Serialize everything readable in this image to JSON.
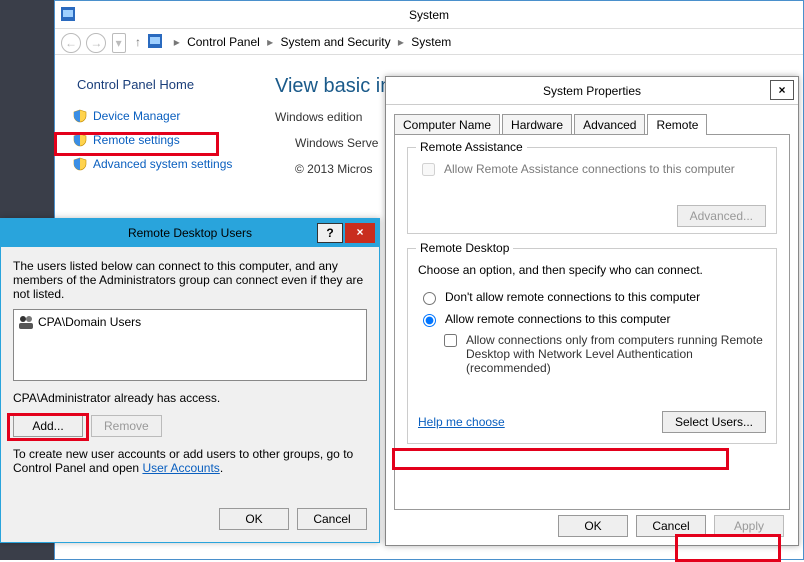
{
  "system_window": {
    "title": "System",
    "breadcrumb": {
      "seg1": "Control Panel",
      "seg2": "System and Security",
      "seg3": "System",
      "arrow": "▸"
    },
    "left": {
      "home": "Control Panel Home",
      "links": {
        "device_mgr": "Device Manager",
        "remote": "Remote settings",
        "advsys": "Advanced system settings"
      }
    },
    "right": {
      "heading": "View basic info",
      "edition_lbl": "Windows edition",
      "edition_val": "Windows Serve",
      "copyright": "© 2013 Micros"
    }
  },
  "props": {
    "title": "System Properties",
    "close": "×",
    "tabs": {
      "cn": "Computer Name",
      "hw": "Hardware",
      "adv": "Advanced",
      "rem": "Remote"
    },
    "ra": {
      "legend": "Remote Assistance",
      "allow": "Allow Remote Assistance connections to this computer",
      "advanced_btn": "Advanced..."
    },
    "rd": {
      "legend": "Remote Desktop",
      "choose": "Choose an option, and then specify who can connect.",
      "opt_deny": "Don't allow remote connections to this computer",
      "opt_allow": "Allow remote connections to this computer",
      "nla": "Allow connections only from computers running Remote Desktop with Network Level Authentication (recommended)",
      "help": "Help me choose",
      "select_users": "Select Users..."
    },
    "btns": {
      "ok": "OK",
      "cancel": "Cancel",
      "apply": "Apply"
    }
  },
  "rdu": {
    "title": "Remote Desktop Users",
    "help": "?",
    "close": "×",
    "desc": "The users listed below can connect to this computer, and any members of the Administrators group can connect even if they are not listed.",
    "list": {
      "item1": "CPA\\Domain Users"
    },
    "already": "CPA\\Administrator already has access.",
    "add": "Add...",
    "remove": "Remove",
    "foot1": "To create new user accounts or add users to other groups, go to Control Panel and open ",
    "foot_link": "User Accounts",
    "foot_dot": ".",
    "ok": "OK",
    "cancel": "Cancel"
  }
}
